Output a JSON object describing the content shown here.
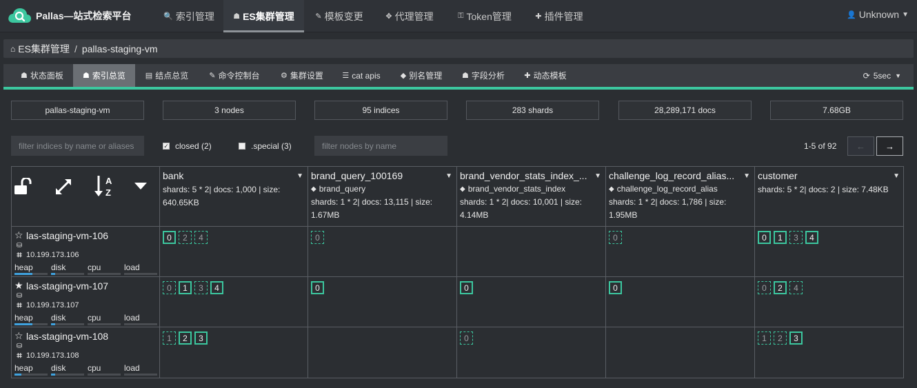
{
  "brand": {
    "title": "Pallas—站式检索平台",
    "accent": "#3cc79f"
  },
  "nav": [
    {
      "label": "索引管理",
      "icon": "search-icon",
      "glyph": "🔍"
    },
    {
      "label": "ES集群管理",
      "icon": "sitemap-icon",
      "glyph": "☗",
      "active": true
    },
    {
      "label": "模板变更",
      "icon": "edit-icon",
      "glyph": "✎"
    },
    {
      "label": "代理管理",
      "icon": "arrows-icon",
      "glyph": "✥"
    },
    {
      "label": "Token管理",
      "icon": "key-icon",
      "glyph": "⚿"
    },
    {
      "label": "插件管理",
      "icon": "puzzle-icon",
      "glyph": "✚"
    }
  ],
  "user": {
    "label": "Unknown"
  },
  "breadcrumb": {
    "parent": "ES集群管理",
    "current": "pallas-staging-vm"
  },
  "subtabs": [
    {
      "label": "状态面板",
      "glyph": "☗"
    },
    {
      "label": "索引总览",
      "glyph": "☗",
      "active": true
    },
    {
      "label": "结点总览",
      "glyph": "▤"
    },
    {
      "label": "命令控制台",
      "glyph": "✎"
    },
    {
      "label": "集群设置",
      "glyph": "⚙"
    },
    {
      "label": "cat apis",
      "glyph": "☰"
    },
    {
      "label": "别名管理",
      "glyph": "◆"
    },
    {
      "label": "字段分析",
      "glyph": "☗"
    },
    {
      "label": "动态模板",
      "glyph": "✚"
    }
  ],
  "refresh": {
    "label": "5sec"
  },
  "stats": [
    "pallas-staging-vm",
    "3 nodes",
    "95 indices",
    "283 shards",
    "28,289,171 docs",
    "7.68GB"
  ],
  "filters": {
    "indices_placeholder": "filter indices by name or aliases",
    "nodes_placeholder": "filter nodes by name",
    "closed_label": "closed (2)",
    "special_label": ".special (3)"
  },
  "pager": {
    "text": "1-5 of 92",
    "prev": "←",
    "next": "→"
  },
  "indices": [
    {
      "name": "bank",
      "alias": "",
      "stats": "shards: 5 * 2| docs: 1,000 | size: 640.65KB"
    },
    {
      "name": "brand_query_100169",
      "alias": "brand_query",
      "stats": "shards: 1 * 2| docs: 13,115 | size: 1.67MB"
    },
    {
      "name": "brand_vendor_stats_index_...",
      "alias": "brand_vendor_stats_index",
      "stats": "shards: 1 * 2| docs: 10,001 | size: 4.14MB"
    },
    {
      "name": "challenge_log_record_alias...",
      "alias": "challenge_log_record_alias",
      "stats": "shards: 1 * 2| docs: 1,786 | size: 1.95MB"
    },
    {
      "name": "customer",
      "alias": "",
      "stats": "shards: 5 * 2| docs: 2 | size: 7.48KB"
    }
  ],
  "nodes": [
    {
      "name": "las-staging-vm-106",
      "ip": "10.199.173.106",
      "master": false,
      "meters": [
        {
          "label": "heap",
          "value": 0.55
        },
        {
          "label": "disk",
          "value": 0.12
        },
        {
          "label": "cpu",
          "value": 0
        },
        {
          "label": "load",
          "value": 0
        }
      ],
      "shards": [
        [
          {
            "n": "0",
            "p": true
          },
          {
            "n": "2",
            "p": false
          },
          {
            "n": "4",
            "p": false
          }
        ],
        [
          {
            "n": "0",
            "p": false
          }
        ],
        [],
        [
          {
            "n": "0",
            "p": false
          }
        ],
        [
          {
            "n": "0",
            "p": true
          },
          {
            "n": "1",
            "p": true
          },
          {
            "n": "3",
            "p": false
          },
          {
            "n": "4",
            "p": true
          }
        ]
      ]
    },
    {
      "name": "las-staging-vm-107",
      "ip": "10.199.173.107",
      "master": true,
      "meters": [
        {
          "label": "heap",
          "value": 0.55
        },
        {
          "label": "disk",
          "value": 0.12
        },
        {
          "label": "cpu",
          "value": 0
        },
        {
          "label": "load",
          "value": 0
        }
      ],
      "shards": [
        [
          {
            "n": "0",
            "p": false
          },
          {
            "n": "1",
            "p": true
          },
          {
            "n": "3",
            "p": false
          },
          {
            "n": "4",
            "p": true
          }
        ],
        [
          {
            "n": "0",
            "p": true
          }
        ],
        [
          {
            "n": "0",
            "p": true
          }
        ],
        [
          {
            "n": "0",
            "p": true
          }
        ],
        [
          {
            "n": "0",
            "p": false
          },
          {
            "n": "2",
            "p": true
          },
          {
            "n": "4",
            "p": false
          }
        ]
      ]
    },
    {
      "name": "las-staging-vm-108",
      "ip": "10.199.173.108",
      "master": false,
      "meters": [
        {
          "label": "heap",
          "value": 0.2
        },
        {
          "label": "disk",
          "value": 0.12
        },
        {
          "label": "cpu",
          "value": 0
        },
        {
          "label": "load",
          "value": 0
        }
      ],
      "shards": [
        [
          {
            "n": "1",
            "p": false
          },
          {
            "n": "2",
            "p": true
          },
          {
            "n": "3",
            "p": true
          }
        ],
        [],
        [
          {
            "n": "0",
            "p": false
          }
        ],
        [],
        [
          {
            "n": "1",
            "p": false
          },
          {
            "n": "2",
            "p": false
          },
          {
            "n": "3",
            "p": true
          }
        ]
      ]
    }
  ]
}
